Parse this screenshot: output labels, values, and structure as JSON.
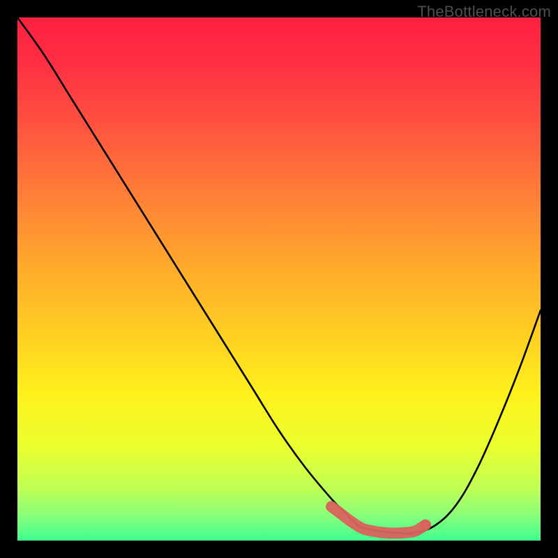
{
  "watermark": "TheBottleneck.com",
  "colors": {
    "frame": "#000000",
    "curve": "#000000",
    "marker_fill": "#d9635d",
    "marker_stroke": "#d9635d",
    "gradient_stops": [
      {
        "offset": 0.0,
        "color": "#ff2040"
      },
      {
        "offset": 0.08,
        "color": "#ff2d43"
      },
      {
        "offset": 0.2,
        "color": "#ff5140"
      },
      {
        "offset": 0.35,
        "color": "#ff8236"
      },
      {
        "offset": 0.5,
        "color": "#ffb129"
      },
      {
        "offset": 0.62,
        "color": "#ffd321"
      },
      {
        "offset": 0.72,
        "color": "#fff11c"
      },
      {
        "offset": 0.82,
        "color": "#eaff2e"
      },
      {
        "offset": 0.9,
        "color": "#c0ff55"
      },
      {
        "offset": 0.95,
        "color": "#8cff79"
      },
      {
        "offset": 1.0,
        "color": "#3fff8f"
      }
    ]
  },
  "chart_data": {
    "type": "line",
    "title": "",
    "xlabel": "",
    "ylabel": "",
    "xlim": [
      0,
      100
    ],
    "ylim": [
      0,
      100
    ],
    "grid": false,
    "legend": false,
    "series": [
      {
        "name": "bottleneck-curve",
        "x": [
          0,
          5,
          10,
          15,
          20,
          25,
          30,
          35,
          40,
          45,
          50,
          55,
          60,
          62,
          65,
          68,
          72,
          76,
          80,
          84,
          88,
          92,
          96,
          100
        ],
        "y": [
          100,
          93,
          85,
          77,
          69,
          61,
          53,
          45,
          37,
          29,
          21,
          14,
          8,
          6,
          3,
          2,
          1.5,
          1.5,
          3,
          7,
          14,
          23,
          33,
          44
        ]
      }
    ],
    "highlight": {
      "name": "valley-band",
      "x": [
        60,
        62,
        64,
        66,
        68,
        70,
        72,
        74,
        76,
        78
      ],
      "y": [
        6.5,
        5.0,
        3.5,
        2.3,
        1.8,
        1.5,
        1.4,
        1.5,
        1.8,
        3.0
      ]
    }
  }
}
